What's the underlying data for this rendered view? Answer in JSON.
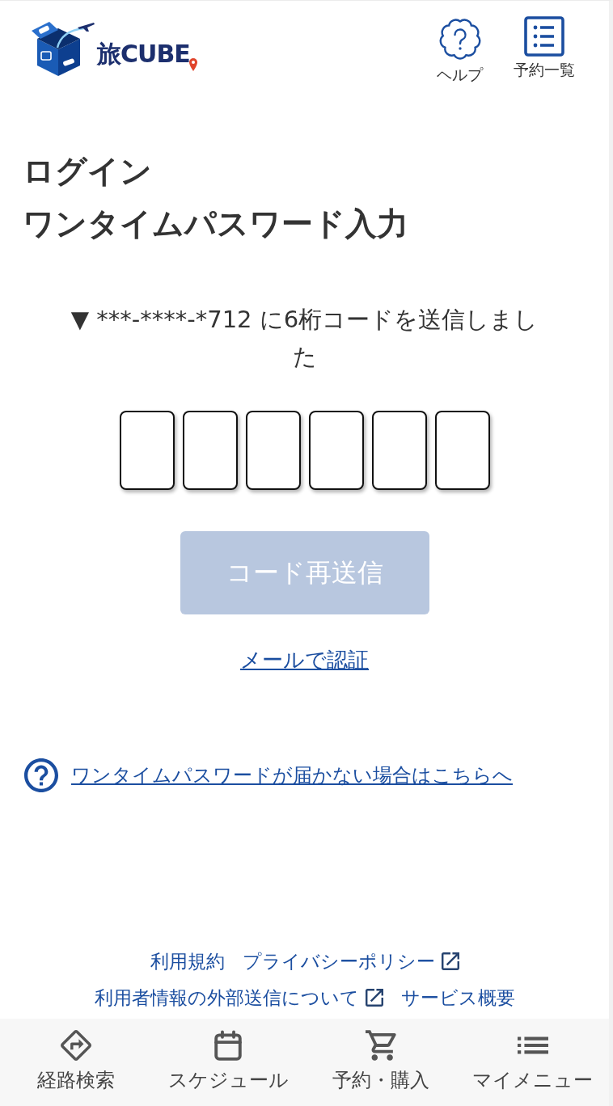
{
  "header": {
    "logo": {
      "wordmark": "旅CUBE"
    },
    "actions": [
      {
        "kind": "help",
        "label": "ヘルプ"
      },
      {
        "kind": "list",
        "label": "予約一覧"
      }
    ]
  },
  "title": {
    "main": "ログイン",
    "sub": "ワンタイムパスワード入力"
  },
  "message": "▼ ***-****-*712 に6桁コードを送信しました",
  "code_fields": [
    {
      "focused": false
    },
    {
      "focused": false
    },
    {
      "focused": false
    },
    {
      "focused": false
    },
    {
      "focused": false
    },
    {
      "focused": false
    }
  ],
  "resend_button": {
    "label": "コード再送信",
    "disabled": true
  },
  "mail_link": "メールで認証",
  "help_link": "ワンタイムパスワードが届かない場合はこちらへ",
  "footer": {
    "rows": [
      {
        "links": [
          {
            "label": "利用規約",
            "external": false
          },
          {
            "label": "プライバシーポリシー",
            "external": true
          }
        ]
      },
      {
        "links": [
          {
            "label": "利用者情報の外部送信について",
            "external": true
          },
          {
            "label": "サービス概要",
            "external": false
          }
        ]
      }
    ]
  },
  "bottom_nav": [
    {
      "kind": "route",
      "label": "経路検索"
    },
    {
      "kind": "calendar",
      "label": "スケジュール"
    },
    {
      "kind": "cart",
      "label": "予約・購入"
    },
    {
      "kind": "menu",
      "label": "マイメニュー"
    }
  ]
}
